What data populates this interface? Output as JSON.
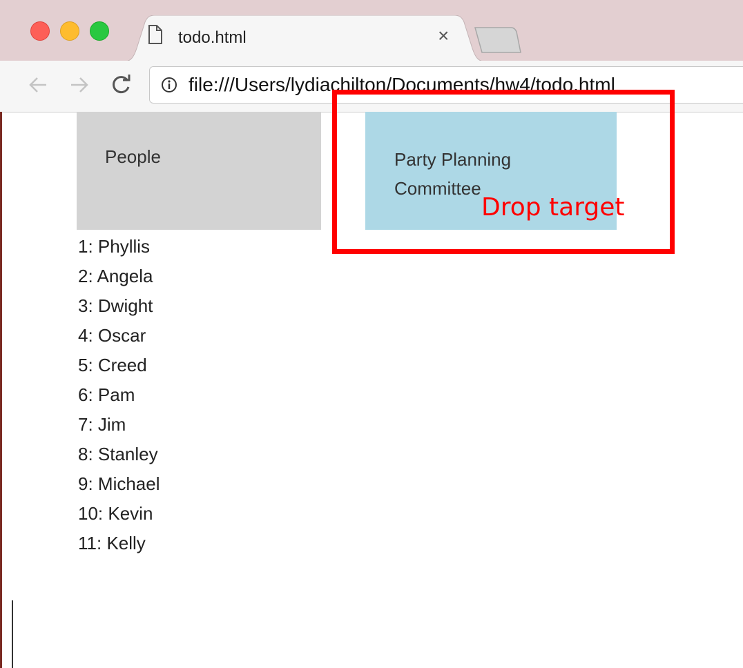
{
  "browser": {
    "tab_title": "todo.html",
    "tab_close": "×",
    "url": "file:///Users/lydiachilton/Documents/hw4/todo.html",
    "icons": [
      "document-icon",
      "close-icon",
      "back-arrow-icon",
      "forward-arrow-icon",
      "reload-icon",
      "info-icon"
    ]
  },
  "page": {
    "people_header": "People",
    "party_header": "Party Planning Committee",
    "people": [
      "1: Phyllis",
      "2: Angela",
      "3: Dwight",
      "4: Oscar",
      "5: Creed",
      "6: Pam",
      "7: Jim",
      "8: Stanley",
      "9: Michael",
      "10: Kevin",
      "11: Kelly"
    ]
  },
  "annotation": {
    "label": "Drop target",
    "color": "#ff0000"
  },
  "colors": {
    "people_box": "#d3d3d3",
    "party_box": "#add8e6",
    "titlebar": "#e3cfd1"
  }
}
